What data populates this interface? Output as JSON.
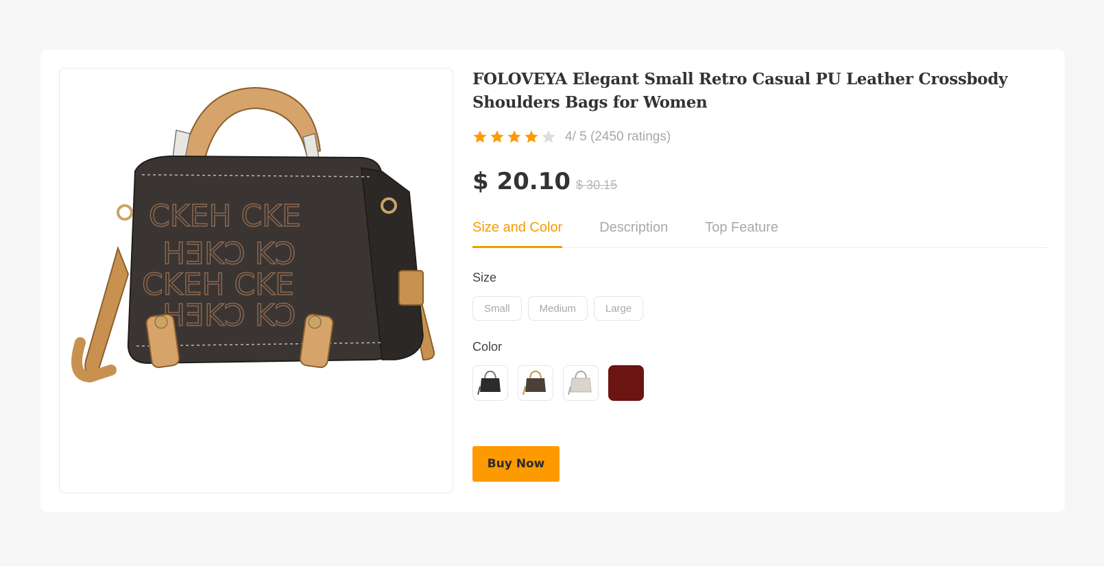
{
  "product": {
    "title": "FOLOVEYA Elegant Small Retro Casual PU Leather Crossbody Shoulders Bags for Women",
    "image_icon": "handbag-image",
    "rating": {
      "value": 4,
      "max": 5,
      "text": "4/ 5 (2450 ratings)"
    },
    "price": "$ 20.10",
    "old_price": "$ 30.15"
  },
  "tabs": [
    {
      "label": "Size and Color",
      "active": true
    },
    {
      "label": "Description",
      "active": false
    },
    {
      "label": "Top Feature",
      "active": false
    }
  ],
  "size": {
    "label": "Size",
    "options": [
      "Small",
      "Medium",
      "Large"
    ]
  },
  "color": {
    "label": "Color",
    "swatches": [
      {
        "name": "black-bag-thumbnail",
        "color": "#2b2b2b"
      },
      {
        "name": "brown-bag-thumbnail",
        "color": "#5a4b3c"
      },
      {
        "name": "white-bag-thumbnail",
        "color": "#d9d4cc"
      },
      {
        "name": "burgundy-swatch",
        "color": "#6b1412"
      }
    ]
  },
  "actions": {
    "buy_label": "Buy Now"
  },
  "colors": {
    "accent": "#fd9a00",
    "star_filled": "#fb9b05",
    "star_empty": "#dcdcdc"
  }
}
